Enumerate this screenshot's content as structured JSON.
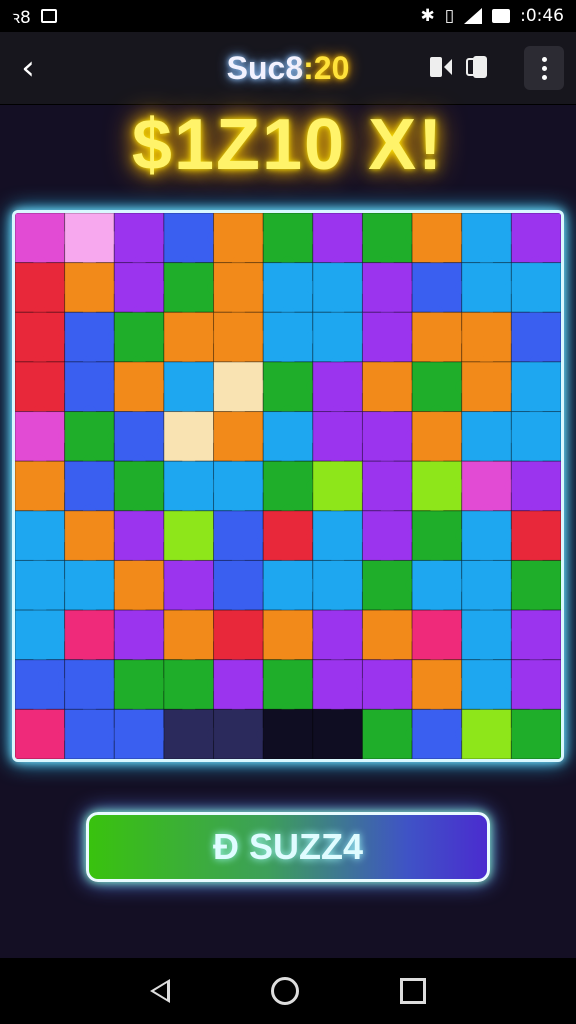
{
  "status_bar": {
    "left_label": "ꝛ8",
    "time": ":0:46",
    "icons": [
      "app-notification-icon",
      "media-icon",
      "bluetooth-icon",
      "vibrate-icon",
      "signal-icon",
      "battery-icon"
    ]
  },
  "header": {
    "title_part1": "Suc8",
    "title_part2": ":20",
    "icons": [
      "back-arrow-icon",
      "video-icon",
      "cards-icon",
      "more-vert-icon"
    ]
  },
  "banner": {
    "text": "$1Z10 X!"
  },
  "action_button": {
    "label": "Ð SUZZ4"
  },
  "colors": {
    "accent_yellow": "#ffe600",
    "board_glow": "#34c8ff",
    "button_green": "#39c20e",
    "button_purple": "#4a2ccf"
  },
  "puzzle": {
    "palette": {
      "P": "#9b34ee",
      "M": "#e24bd4",
      "L": "#f7a8ee",
      "B": "#3a5ff0",
      "C": "#1ea7f0",
      "T": "#2fd2e6",
      "G": "#1fae2a",
      "Y": "#8ee61a",
      "O": "#f28a1a",
      "R": "#e8283a",
      "K": "#ef2a7a",
      "F": "#f9e3b2",
      "N": "#2b2a5c",
      "E": "#0f0d22"
    },
    "grid": [
      "MLPBOGPGOCP",
      "ROPGOCCPBCC",
      "RBGOOCCPOOB",
      "RBOCFGPOGOC",
      "MGBFOCPPOCC",
      "OBGCCGYPYMP",
      "COPYBRCPGCR",
      "CCOPBCCGCCG",
      "CKPOROPOKCP",
      "BBGGPGPPOCP",
      "KBBNNEEGBYG"
    ]
  }
}
